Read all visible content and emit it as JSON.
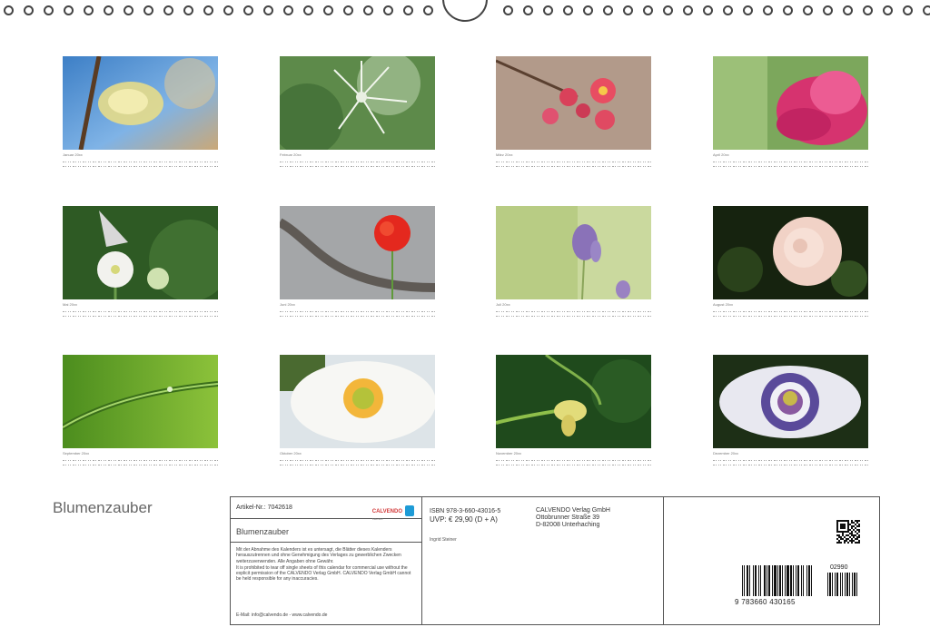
{
  "calendar": {
    "title": "Blumenzauber",
    "months": [
      {
        "label": "Januar 20xx"
      },
      {
        "label": "Februar 20xx"
      },
      {
        "label": "März 20xx"
      },
      {
        "label": "April 20xx"
      },
      {
        "label": "Mai 20xx"
      },
      {
        "label": "Juni 20xx"
      },
      {
        "label": "Juli 20xx"
      },
      {
        "label": "August 20xx"
      },
      {
        "label": "September 20xx"
      },
      {
        "label": "Oktober 20xx"
      },
      {
        "label": "November 20xx"
      },
      {
        "label": "Dezember 20xx"
      }
    ]
  },
  "info": {
    "article": "Artikel-Nr.: 7042618",
    "brand": "CALVENDO",
    "brand_sub": "Kalender",
    "product_name": "Blumenzauber",
    "legal_de": "Mit der Abnahme des Kalenders ist es untersagt, die Blätter dieses Kalenders herauszutrennen und ohne Genehmigung des Verlages zu gewerblichen Zwecken weiterzuverwenden. Alle Angaben ohne Gewähr.",
    "legal_en": "It is prohibited to tear off single sheets of this calendar for commercial use without the explicit permission of the CALVENDO Verlag GmbH. CALVENDO Verlag GmbH cannot be held responsible for any inaccuracies.",
    "email": "E-Mail: info@calvendo.de - www.calvendo.de",
    "isbn": "ISBN 978-3-660-43016-5",
    "price": "UVP: € 29,90 (D + A)",
    "author": "Ingrid Steiner",
    "publisher_name": "CALVENDO Verlag GmbH",
    "publisher_street": "Ottobrunner Straße 39",
    "publisher_city": "D-82008 Unterhaching",
    "barcode_number": "9 783660 430165",
    "addon_number": "02990"
  },
  "colors": {
    "border": "#555555",
    "brand_red": "#d23a3a",
    "brand_blue": "#1e9bd6"
  }
}
